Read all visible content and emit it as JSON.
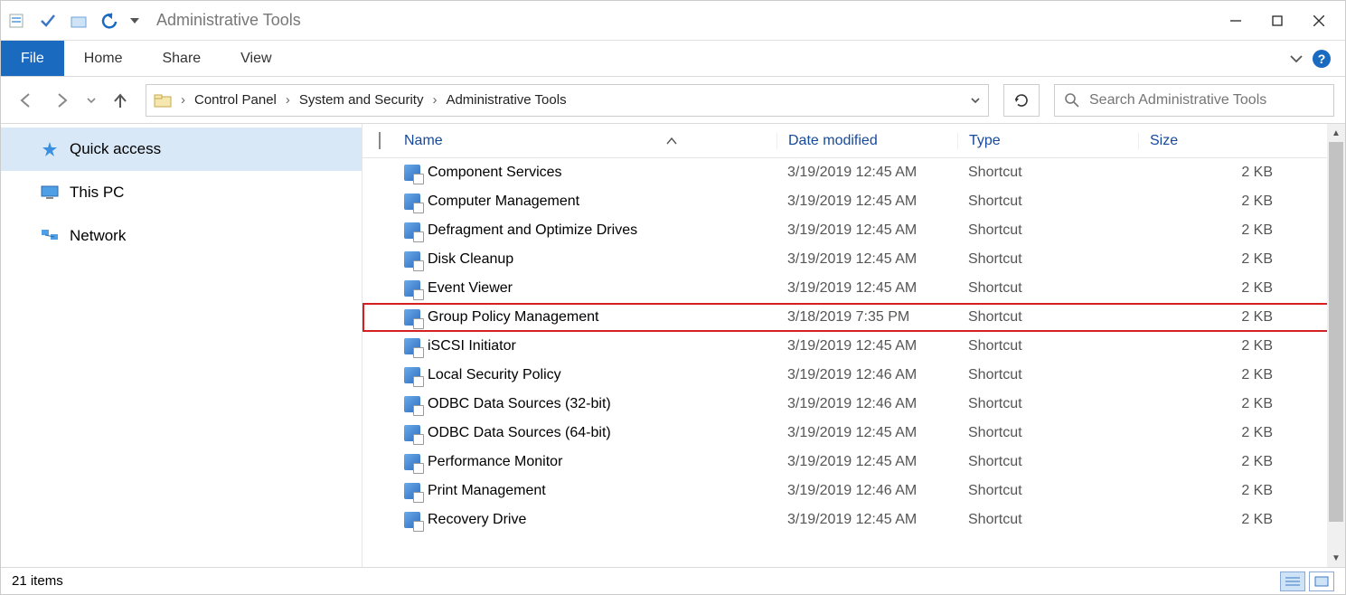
{
  "window_title": "Administrative Tools",
  "ribbon": {
    "file": "File",
    "home": "Home",
    "share": "Share",
    "view": "View"
  },
  "breadcrumb": [
    "Control Panel",
    "System and Security",
    "Administrative Tools"
  ],
  "search": {
    "placeholder": "Search Administrative Tools"
  },
  "sidebar": {
    "items": [
      {
        "label": "Quick access",
        "active": true
      },
      {
        "label": "This PC",
        "active": false
      },
      {
        "label": "Network",
        "active": false
      }
    ]
  },
  "columns": {
    "name": "Name",
    "date": "Date modified",
    "type": "Type",
    "size": "Size"
  },
  "files": [
    {
      "name": "Component Services",
      "date": "3/19/2019 12:45 AM",
      "type": "Shortcut",
      "size": "2 KB",
      "hl": false
    },
    {
      "name": "Computer Management",
      "date": "3/19/2019 12:45 AM",
      "type": "Shortcut",
      "size": "2 KB",
      "hl": false
    },
    {
      "name": "Defragment and Optimize Drives",
      "date": "3/19/2019 12:45 AM",
      "type": "Shortcut",
      "size": "2 KB",
      "hl": false
    },
    {
      "name": "Disk Cleanup",
      "date": "3/19/2019 12:45 AM",
      "type": "Shortcut",
      "size": "2 KB",
      "hl": false
    },
    {
      "name": "Event Viewer",
      "date": "3/19/2019 12:45 AM",
      "type": "Shortcut",
      "size": "2 KB",
      "hl": false
    },
    {
      "name": "Group Policy Management",
      "date": "3/18/2019 7:35 PM",
      "type": "Shortcut",
      "size": "2 KB",
      "hl": true
    },
    {
      "name": "iSCSI Initiator",
      "date": "3/19/2019 12:45 AM",
      "type": "Shortcut",
      "size": "2 KB",
      "hl": false
    },
    {
      "name": "Local Security Policy",
      "date": "3/19/2019 12:46 AM",
      "type": "Shortcut",
      "size": "2 KB",
      "hl": false
    },
    {
      "name": "ODBC Data Sources (32-bit)",
      "date": "3/19/2019 12:46 AM",
      "type": "Shortcut",
      "size": "2 KB",
      "hl": false
    },
    {
      "name": "ODBC Data Sources (64-bit)",
      "date": "3/19/2019 12:45 AM",
      "type": "Shortcut",
      "size": "2 KB",
      "hl": false
    },
    {
      "name": "Performance Monitor",
      "date": "3/19/2019 12:45 AM",
      "type": "Shortcut",
      "size": "2 KB",
      "hl": false
    },
    {
      "name": "Print Management",
      "date": "3/19/2019 12:46 AM",
      "type": "Shortcut",
      "size": "2 KB",
      "hl": false
    },
    {
      "name": "Recovery Drive",
      "date": "3/19/2019 12:45 AM",
      "type": "Shortcut",
      "size": "2 KB",
      "hl": false
    }
  ],
  "status": {
    "count": "21 items"
  }
}
